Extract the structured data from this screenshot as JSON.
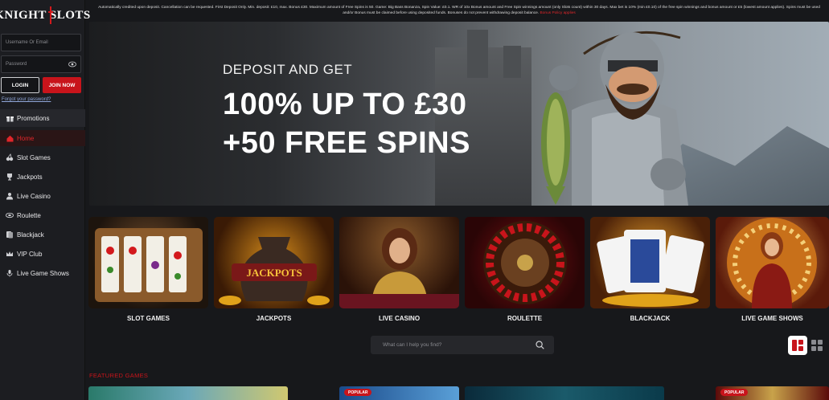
{
  "brand": {
    "logo_left": "KNIGHT",
    "logo_right": "SLOTS",
    "accent": "#c8141b"
  },
  "login": {
    "username_placeholder": "Username Or Email",
    "password_placeholder": "Password",
    "login_label": "LOGIN",
    "join_label": "JOIN NOW",
    "forgot_label": "Forgot your password?"
  },
  "sidebar": {
    "items": [
      {
        "label": "Promotions",
        "icon": "gift-icon"
      },
      {
        "label": "Home",
        "icon": "home-icon"
      },
      {
        "label": "Slot Games",
        "icon": "cherries-icon"
      },
      {
        "label": "Jackpots",
        "icon": "trophy-icon"
      },
      {
        "label": "Live Casino",
        "icon": "dealer-icon"
      },
      {
        "label": "Roulette",
        "icon": "roulette-icon"
      },
      {
        "label": "Blackjack",
        "icon": "cards-icon"
      },
      {
        "label": "VIP Club",
        "icon": "crown-icon"
      },
      {
        "label": "Live Game Shows",
        "icon": "microphone-icon"
      }
    ]
  },
  "terms": {
    "text": "Automatically credited upon deposit. Cancellation can be requested. First Deposit Only. Min. deposit: £10, max. Bonus £30. Maximum amount of Free Spins is 50. Game: Big Bass Bonanza, Spin Value: £0.1. WR of 10x Bonus amount and Free Spin winnings amount (only Slots count) within 30 days. Max bet is 10% (min £0.10) of the free spin winnings and bonus amount or £5 (lowest amount applies). Spins must be used and/or Bonus must be claimed before using deposited funds. Bonuses do not prevent withdrawing deposit balance.",
    "link": "Bonus Policy applies"
  },
  "hero": {
    "subtitle": "DEPOSIT AND GET",
    "line1": "100% UP TO £30",
    "line2": "+50 FREE SPINS"
  },
  "categories": [
    {
      "label": "SLOT GAMES"
    },
    {
      "label": "JACKPOTS"
    },
    {
      "label": "LIVE CASINO"
    },
    {
      "label": "ROULETTE"
    },
    {
      "label": "BLACKJACK"
    },
    {
      "label": "LIVE GAME SHOWS"
    }
  ],
  "search": {
    "placeholder": "What can I help you find?"
  },
  "featured": {
    "title": "FEATURED GAMES",
    "badge": "POPULAR"
  }
}
